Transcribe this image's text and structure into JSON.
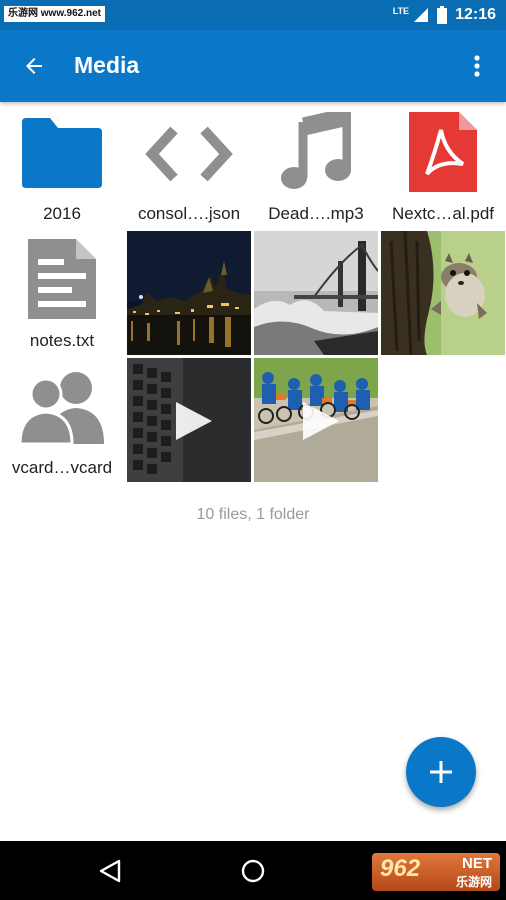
{
  "status_bar": {
    "watermark": "乐游网 www.962.net",
    "network": "LTE",
    "time": "12:16"
  },
  "app_bar": {
    "title": "Media",
    "back_icon": "arrow-back-icon",
    "menu_icon": "more-vert-icon"
  },
  "items": [
    {
      "label": "2016",
      "icon": "folder-icon"
    },
    {
      "label": "consol….json",
      "icon": "code-icon"
    },
    {
      "label": "Dead….mp3",
      "icon": "music-note-icon"
    },
    {
      "label": "Nextc…al.pdf",
      "icon": "pdf-icon"
    },
    {
      "label": "notes.txt",
      "icon": "text-document-icon"
    },
    {
      "label": "vcard…vcard",
      "icon": "contacts-icon"
    }
  ],
  "thumbnails": [
    {
      "kind": "image",
      "subject": "night city"
    },
    {
      "kind": "image",
      "subject": "bridge"
    },
    {
      "kind": "image",
      "subject": "squirrel"
    },
    {
      "kind": "video",
      "subject": "keyboard"
    },
    {
      "kind": "video",
      "subject": "cyclists"
    }
  ],
  "summary": "10 files, 1 folder",
  "fab_icon": "add-icon",
  "nav": {
    "back": "nav-back-icon",
    "home": "nav-home-icon"
  },
  "brand": {
    "main": "962",
    "suffix": "NET",
    "sub": "乐游网"
  },
  "colors": {
    "primary": "#0b77c9",
    "status": "#0a6db4",
    "icon_gray": "#8f8f8f",
    "pdf_red": "#e53935"
  }
}
